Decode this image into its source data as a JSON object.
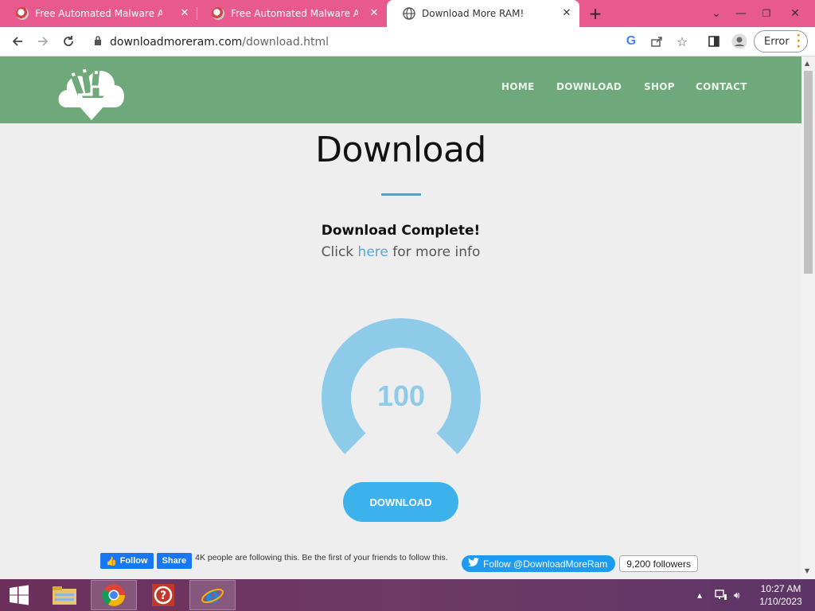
{
  "browser": {
    "tabs": [
      {
        "title": "Free Automated Malware Analysis"
      },
      {
        "title": "Free Automated Malware Analysis"
      },
      {
        "title": "Download More RAM!"
      }
    ],
    "new_tab": "+",
    "url_host": "downloadmoreram.com",
    "url_path": "/download.html",
    "profile_button": "Error"
  },
  "site": {
    "nav": [
      "HOME",
      "DOWNLOAD",
      "SHOP",
      "CONTACT"
    ],
    "title": "Download",
    "status": "Download Complete!",
    "click_prefix": "Click ",
    "click_link": "here",
    "click_suffix": " for more info",
    "progress": 100,
    "progress_label": "100",
    "download_button": "DOWNLOAD",
    "colors": {
      "header": "#6fa87a",
      "gauge": "#8ecbe8",
      "button": "#3db1ec",
      "accent": "#45a6d9"
    }
  },
  "social": {
    "fb_follow": "Follow",
    "fb_share": "Share",
    "fb_text": "4K people are following this. Be the first of your friends to follow this.",
    "tw_follow": "Follow @DownloadMoreRam",
    "tw_count": "9,200 followers"
  },
  "taskbar": {
    "time": "10:27 AM",
    "date": "1/10/2023",
    "apps": [
      "start-icon",
      "file-explorer-icon",
      "chrome-icon",
      "help-icon",
      "internet-explorer-icon"
    ]
  }
}
